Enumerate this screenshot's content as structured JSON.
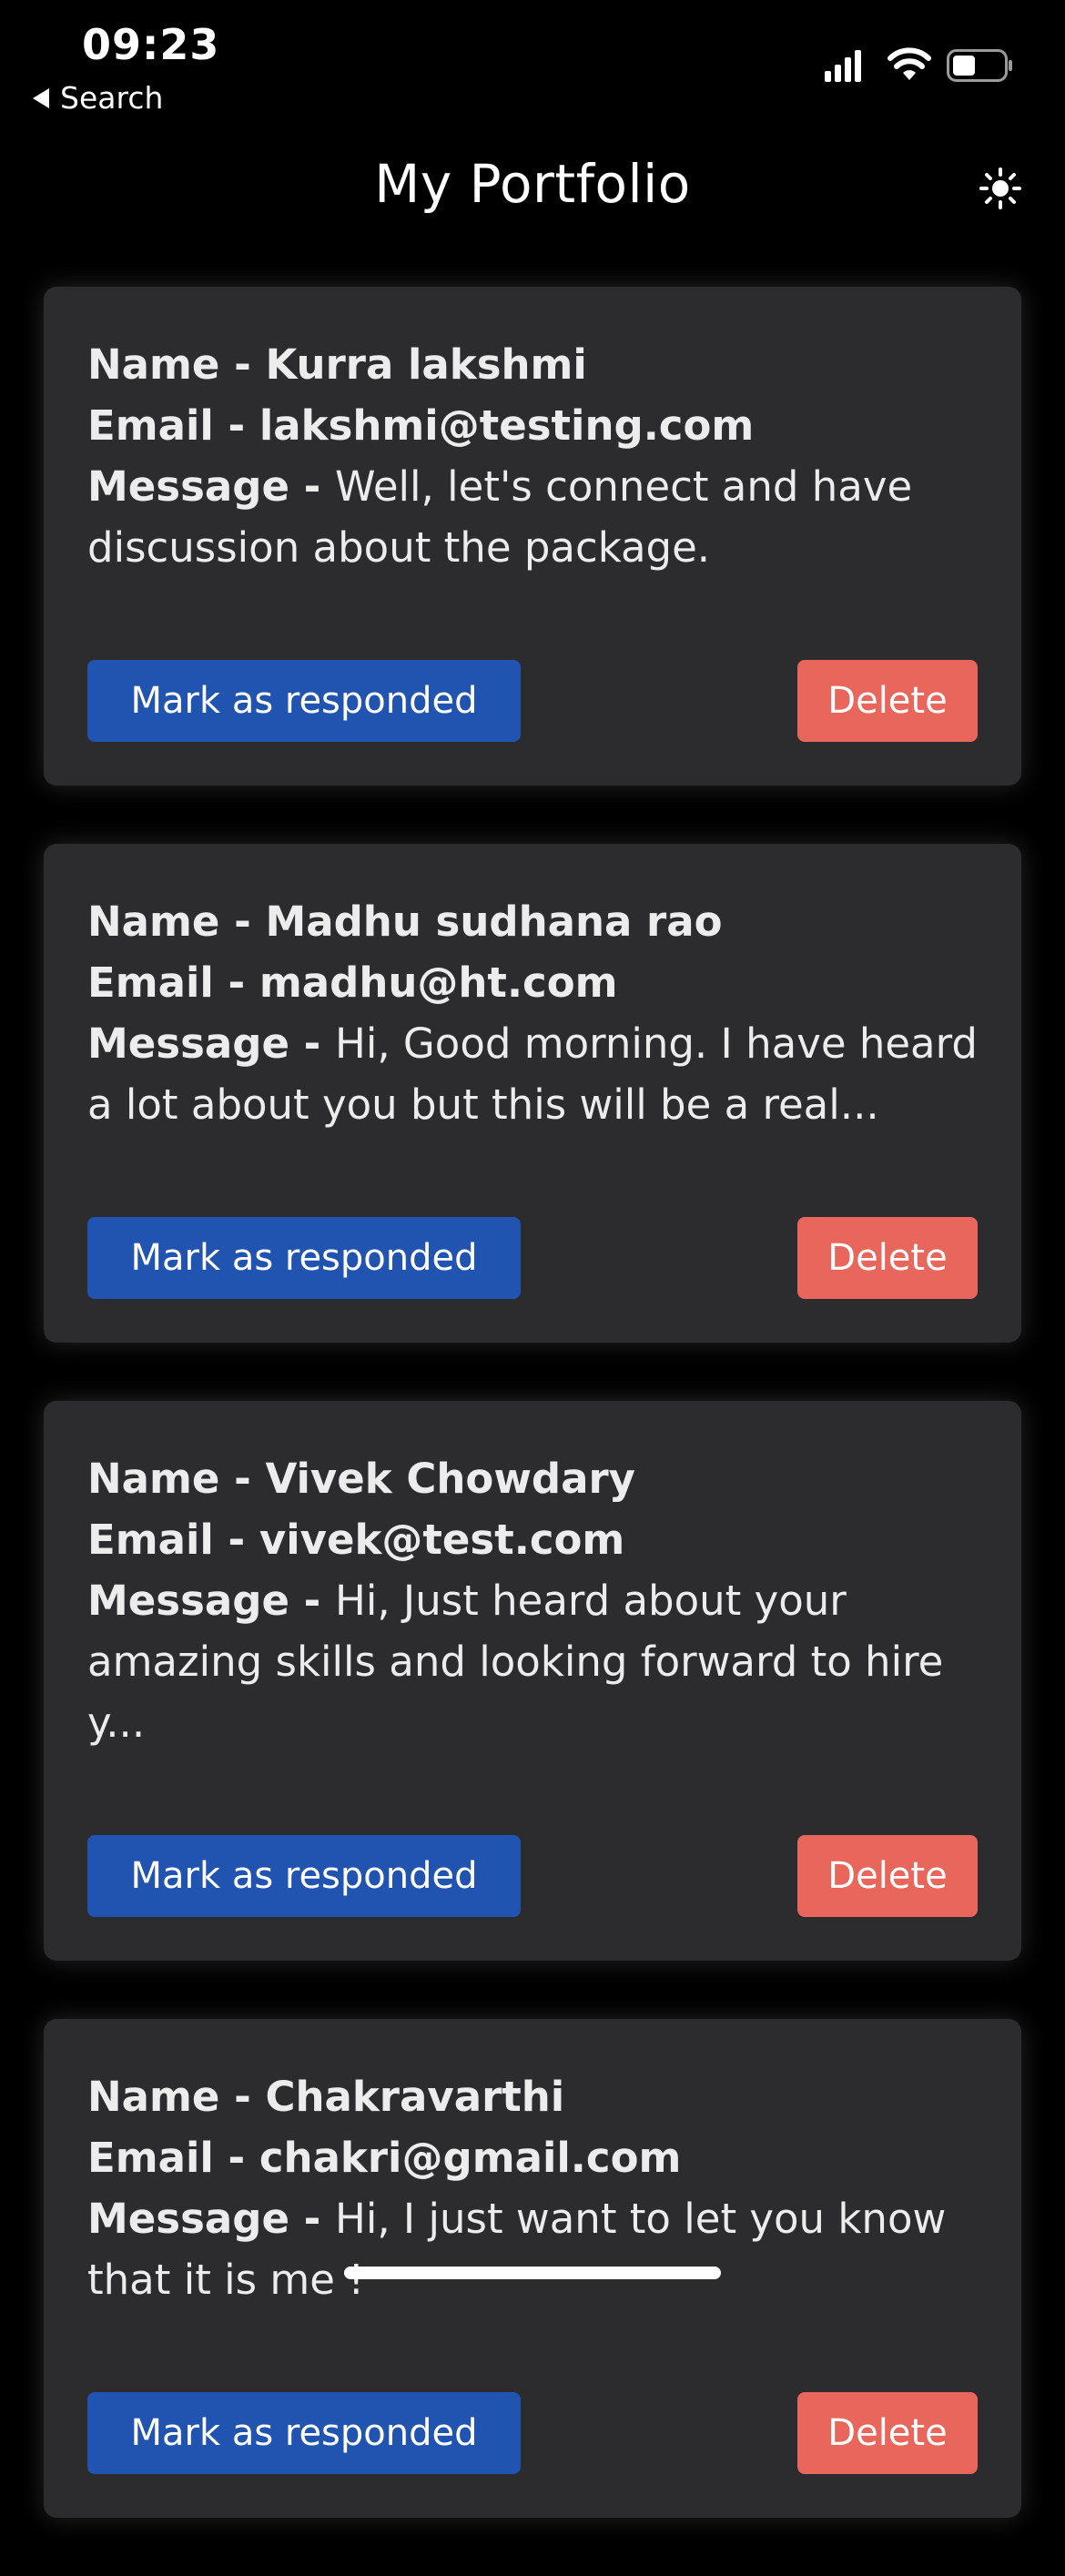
{
  "status_bar": {
    "time": "09:23",
    "back_label": "Search",
    "signal_icon": "cellular-signal-icon",
    "wifi_icon": "wifi-icon",
    "battery_icon": "battery-icon"
  },
  "header": {
    "title": "My Portfolio",
    "theme_icon": "sun-icon"
  },
  "colors": {
    "background": "#000000",
    "card": "#2c2c2e",
    "responded_button": "#2153b0",
    "delete_button": "#e8665b"
  },
  "messages": [
    {
      "name_label": "Name - ",
      "name": "Kurra lakshmi",
      "email_label": "Email - ",
      "email": "lakshmi@testing.com",
      "message_label": "Message - ",
      "message": " Well, let's connect and have discussion about the package.",
      "responded_label": "Mark as responded",
      "delete_label": "Delete"
    },
    {
      "name_label": "Name - ",
      "name": "Madhu sudhana rao",
      "email_label": "Email - ",
      "email": "madhu@ht.com",
      "message_label": "Message - ",
      "message": " Hi, Good morning. I have heard a lot about you but this will be a real...",
      "responded_label": "Mark as responded",
      "delete_label": "Delete"
    },
    {
      "name_label": "Name - ",
      "name": "Vivek Chowdary",
      "email_label": "Email - ",
      "email": "vivek@test.com",
      "message_label": "Message - ",
      "message": " Hi, Just heard about your amazing skills and looking forward to hire y...",
      "responded_label": "Mark as responded",
      "delete_label": "Delete"
    },
    {
      "name_label": "Name - ",
      "name": "Chakravarthi",
      "email_label": "Email - ",
      "email": "chakri@gmail.com",
      "message_label": "Message - ",
      "message": " Hi, I just want to let you know that it is me !",
      "responded_label": "Mark as responded",
      "delete_label": "Delete"
    }
  ]
}
